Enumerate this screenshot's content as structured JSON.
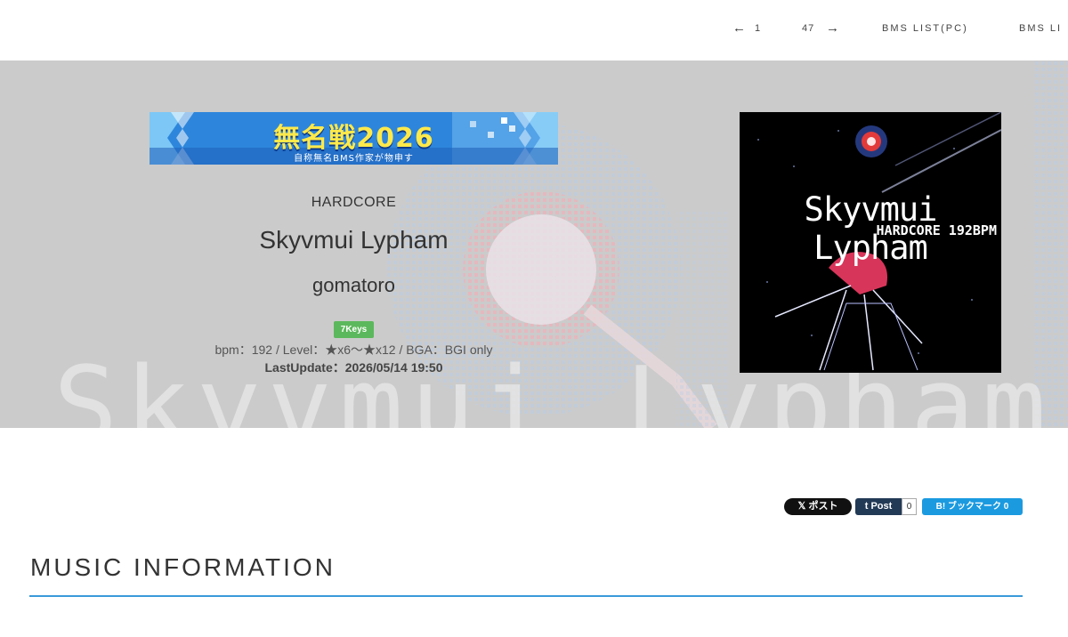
{
  "nav": {
    "prev_arrow": "←",
    "prev_label": "1",
    "next_label": "47",
    "next_arrow": "→",
    "bms_list_pc": "BMS LIST(PC)",
    "bms_list_sp": "BMS LI"
  },
  "hero": {
    "banner": {
      "title": "無名戦2026",
      "subtitle": "自称無名BMS作家が物申す"
    },
    "genre": "HARDCORE",
    "title": "Skyvmui Lypham",
    "artist": "gomatoro",
    "keys_badge": "7Keys",
    "meta": "bpm：192 / Level：★x6〜★x12 / BGA：BGI only",
    "last_update": "LastUpdate：2026/05/14 19:50",
    "background_text": "Skyvmui Lypham"
  },
  "jacket": {
    "title": "Skyvmui Lypham",
    "subtitle": "HARDCORE 192BPM"
  },
  "share": {
    "x_label": "𝕏 ポスト",
    "tumblr_label": "t Post",
    "tumblr_count": "0",
    "hatena_label": "B! ブックマーク  0"
  },
  "section": {
    "title": "MUSIC INFORMATION"
  },
  "colors": {
    "hero_bg": "#cbcbcb",
    "badge_green": "#5cb85c",
    "accent_blue": "#3a9ad9",
    "hatena_blue": "#1b9ae0",
    "tumblr_navy": "#233a56"
  }
}
